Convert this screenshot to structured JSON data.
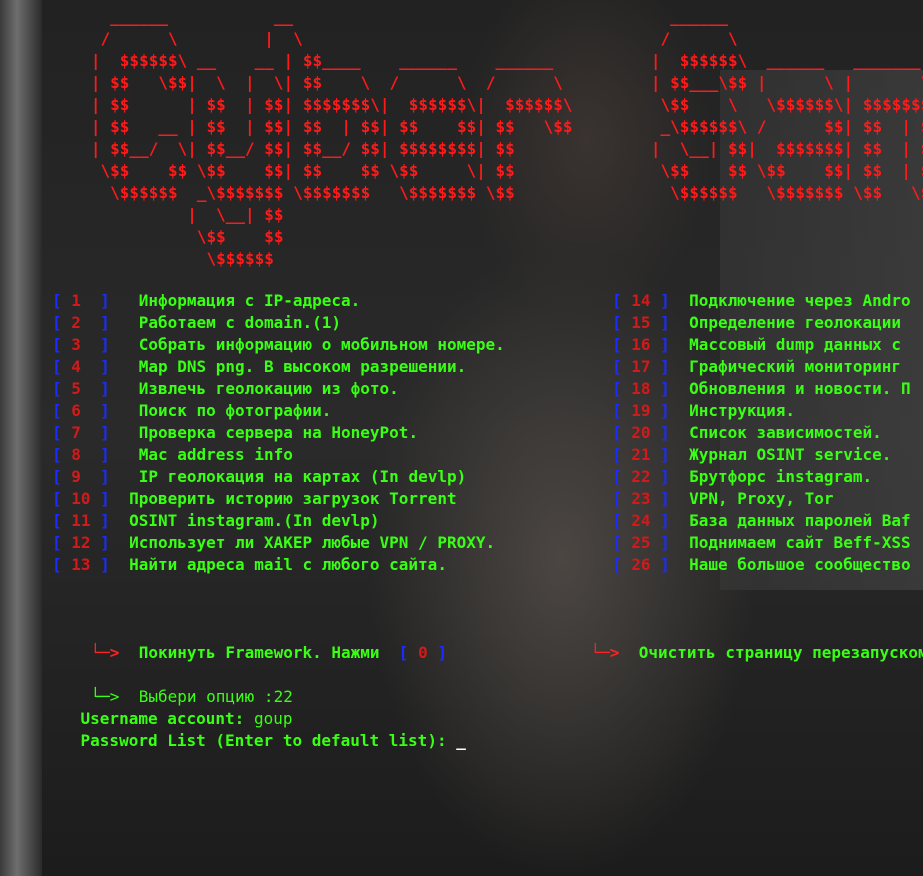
{
  "banner": {
    "left": "     ______           __\n    /      \\         |  \\\n   |  $$$$$$\\ __    __ | $$____    ______    ______\n   | $$   \\$$|  \\  |  \\| $$    \\  /      \\  /      \\\n   | $$      | $$  | $$| $$$$$$$\\|  $$$$$$\\|  $$$$$$\\\n   | $$   __ | $$  | $$| $$  | $$| $$    $$| $$   \\$$\n   | $$__/  \\| $$__/ $$| $$__/ $$| $$$$$$$$| $$\n    \\$$    $$ \\$$    $$| $$    $$ \\$$     \\| $$\n     \\$$$$$$  _\\$$$$$$$ \\$$$$$$$   \\$$$$$$$ \\$$\n             |  \\__| $$\n              \\$$    $$\n               \\$$$$$$",
    "right": "     ______\n    /      \\\n   |  $$$$$$\\  ______   _______\n   | $$___\\$$ |      \\ |       \\\n    \\$$    \\   \\$$$$$$\\| $$$$$$$\\\n    _\\$$$$$$\\ /      $$| $$  | $$\n   |  \\__| $$|  $$$$$$$| $$  | $$\n    \\$$    $$ \\$$    $$| $$  | $$\n     \\$$$$$$   \\$$$$$$$ \\$$   \\$$"
  },
  "menu": {
    "left": [
      {
        "num": "1",
        "label": "Информация с IP-адреса."
      },
      {
        "num": "2",
        "label": "Работаем с domain.(1)"
      },
      {
        "num": "3",
        "label": "Собрать информацию о мобильном номере."
      },
      {
        "num": "4",
        "label": "Map DNS png. В высоком разрешении."
      },
      {
        "num": "5",
        "label": "Извлечь геолокацию из фото."
      },
      {
        "num": "6",
        "label": "Поиск по фотографии."
      },
      {
        "num": "7",
        "label": "Проверка сервера на HoneyPot."
      },
      {
        "num": "8",
        "label": "Mac address info"
      },
      {
        "num": "9",
        "label": "IP геолокация на картах (In devlp)"
      },
      {
        "num": "10",
        "label": "Проверить историю загрузок Torrent"
      },
      {
        "num": "11",
        "label": "OSINT instagram.(In devlp)"
      },
      {
        "num": "12",
        "label": "Использует ли ХАКЕР любые VPN / PROXY."
      },
      {
        "num": "13",
        "label": "Найти адреса mail с любого сайта."
      }
    ],
    "right": [
      {
        "num": "14",
        "label": "Подключение через Andro"
      },
      {
        "num": "15",
        "label": "Определение геолокации "
      },
      {
        "num": "16",
        "label": "Массовый dump данных с "
      },
      {
        "num": "17",
        "label": "Графический мониторинг "
      },
      {
        "num": "18",
        "label": "Обновления и новости. П"
      },
      {
        "num": "19",
        "label": "Инструкция."
      },
      {
        "num": "20",
        "label": "Список зависимостей."
      },
      {
        "num": "21",
        "label": "Журнал OSINT service."
      },
      {
        "num": "22",
        "label": "Брутфорс instagram."
      },
      {
        "num": "23",
        "label": "VPN, Proxy, Tor"
      },
      {
        "num": "24",
        "label": "База данных паролей Baf"
      },
      {
        "num": "25",
        "label": "Поднимаем сайт Beff-XSS"
      },
      {
        "num": "26",
        "label": "Наше большое сообщество"
      }
    ]
  },
  "footer": {
    "arrow": "└─>",
    "exit_text": "Покинуть Framework. Нажми",
    "exit_num": "0",
    "clear_text": "Очистить страницу перезапуском."
  },
  "prompt": {
    "arrow": "└─>",
    "label": "Выбери опцию :",
    "value": "22"
  },
  "input": {
    "username_label": "Username account:",
    "username_value": "goup",
    "password_label": "Password List (Enter to default list):",
    "cursor": "_"
  },
  "colors": {
    "banner": "#ff1a1a",
    "menu_bracket": "#1a2cff",
    "menu_number": "#d21a1a",
    "menu_label": "#39ff14",
    "text": "#ffffff"
  }
}
